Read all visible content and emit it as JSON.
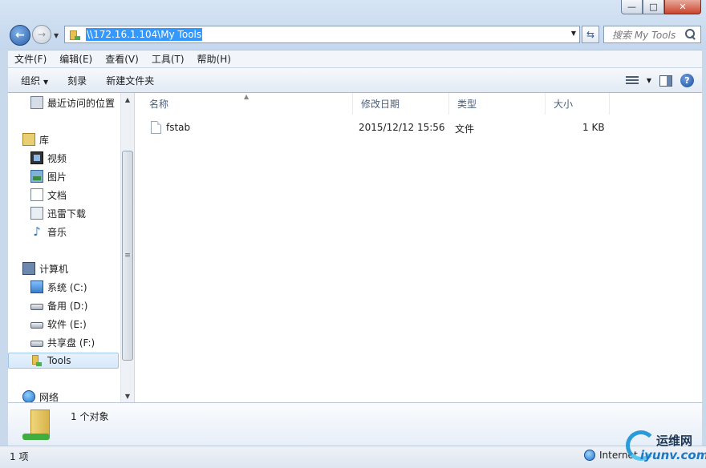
{
  "window": {
    "minimize_glyph": "—",
    "maximize_glyph": "□",
    "close_glyph": "✕"
  },
  "nav": {
    "address": "\\\\172.16.1.104\\My Tools",
    "search_placeholder": "搜索 My Tools"
  },
  "menu": [
    "文件(F)",
    "编辑(E)",
    "查看(V)",
    "工具(T)",
    "帮助(H)"
  ],
  "commands": {
    "organize": "组织",
    "burn": "刻录",
    "new_folder": "新建文件夹"
  },
  "sidebar": {
    "items": [
      {
        "label": "最近访问的位置",
        "icon": "recent-places-icon"
      },
      {
        "label": "库",
        "icon": "library-icon"
      },
      {
        "label": "视频",
        "icon": "video-icon"
      },
      {
        "label": "图片",
        "icon": "picture-icon"
      },
      {
        "label": "文档",
        "icon": "document-icon"
      },
      {
        "label": "迅雷下载",
        "icon": "download-icon"
      },
      {
        "label": "音乐",
        "icon": "music-icon"
      },
      {
        "label": "计算机",
        "icon": "computer-icon"
      },
      {
        "label": "系统 (C:)",
        "icon": "system-drive-icon"
      },
      {
        "label": "备用 (D:)",
        "icon": "drive-icon"
      },
      {
        "label": "软件 (E:)",
        "icon": "drive-icon"
      },
      {
        "label": "共享盘 (F:)",
        "icon": "drive-icon"
      },
      {
        "label": "Tools",
        "icon": "network-folder-icon",
        "selected": true
      },
      {
        "label": "网络",
        "icon": "network-icon"
      }
    ]
  },
  "columns": {
    "name": "名称",
    "modified": "修改日期",
    "type": "类型",
    "size": "大小"
  },
  "files": [
    {
      "name": "fstab",
      "modified": "2015/12/12 15:56",
      "type": "文件",
      "size": "1 KB"
    }
  ],
  "details": {
    "count": "1 个对象"
  },
  "status": {
    "items": "1 项",
    "zone": "Internet"
  },
  "watermark": {
    "cn": "运维网",
    "en": "iyunv.com"
  }
}
